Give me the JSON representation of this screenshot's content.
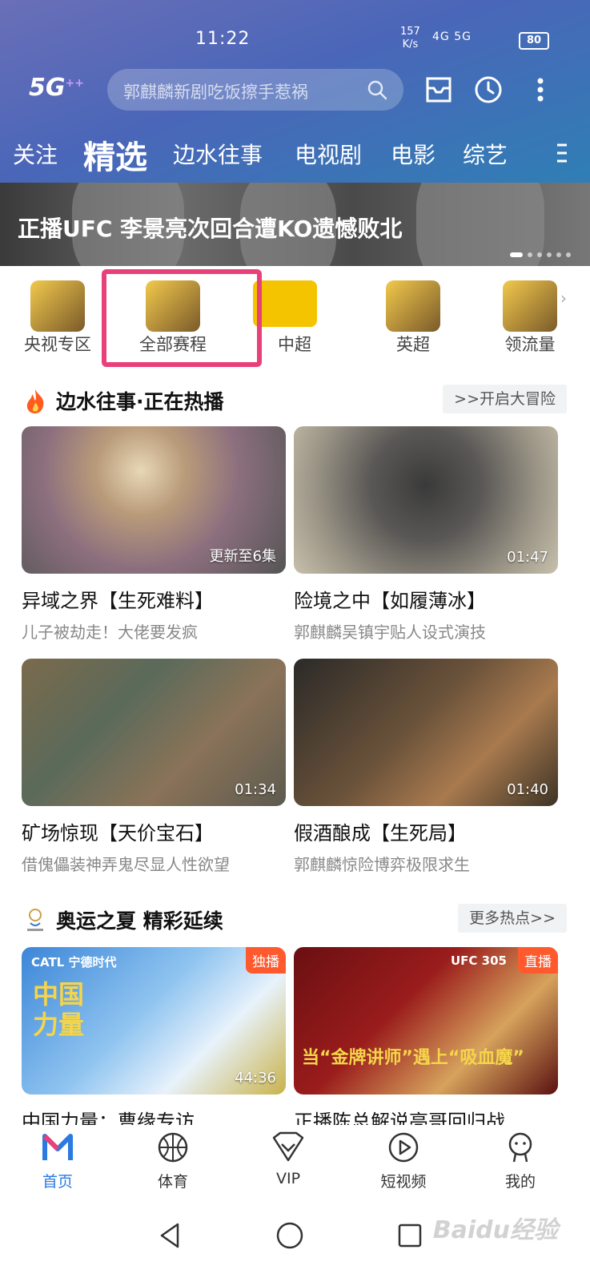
{
  "status_bar": {
    "time": "11:22",
    "net_speed": "157",
    "net_unit": "K/s",
    "signal": "4G 5G",
    "battery": "80"
  },
  "header": {
    "logo": "5G",
    "search_placeholder": "郭麒麟新剧吃饭擦手惹祸",
    "icons": [
      "search-icon",
      "inbox-icon",
      "history-icon",
      "more-icon"
    ]
  },
  "tabs": [
    {
      "label": "关注",
      "active": false
    },
    {
      "label": "精选",
      "active": true
    },
    {
      "label": "边水往事",
      "active": false
    },
    {
      "label": "电视剧",
      "active": false
    },
    {
      "label": "电影",
      "active": false
    },
    {
      "label": "综艺",
      "active": false
    }
  ],
  "banner": {
    "title": "正播UFC 李景亮次回合遭KO遗憾败北",
    "page_count": 6,
    "current_page": 1
  },
  "channels": [
    {
      "label": "央视专区"
    },
    {
      "label": "全部赛程"
    },
    {
      "label": "中超"
    },
    {
      "label": "英超"
    },
    {
      "label": "领流量"
    }
  ],
  "section1": {
    "title": "边水往事·正在热播",
    "more": ">>开启大冒险",
    "cards": [
      {
        "title": "异域之界【生死难料】",
        "subtitle": "儿子被劫走！大佬要发疯",
        "badge": "更新至6集"
      },
      {
        "title": "险境之中【如履薄冰】",
        "subtitle": "郭麒麟吴镇宇贴人设式演技",
        "badge": "01:47"
      },
      {
        "title": "矿场惊现【天价宝石】",
        "subtitle": "借傀儡装神弄鬼尽显人性欲望",
        "badge": "01:34"
      },
      {
        "title": "假酒酿成【生死局】",
        "subtitle": "郭麒麟惊险博弈极限求生",
        "badge": "01:40"
      }
    ]
  },
  "section2": {
    "title": "奥运之夏 精彩延续",
    "more": "更多热点>>",
    "cards": [
      {
        "title": "中国力量：曹缘专访",
        "tag": "独播",
        "badge": "44:36",
        "overlay_brand": "CATL 宁德时代",
        "overlay_big": "中国力量"
      },
      {
        "title": "正播陈总解说亮哥回归战",
        "tag": "直播",
        "overlay_brand": "UFC 305",
        "overlay_big": "当“金牌讲师”遇上“吸血魔”"
      }
    ]
  },
  "bottom_nav": [
    {
      "label": "首页",
      "icon": "home-logo-icon",
      "active": true
    },
    {
      "label": "体育",
      "icon": "basketball-icon",
      "active": false
    },
    {
      "label": "VIP",
      "icon": "vip-icon",
      "active": false
    },
    {
      "label": "短视频",
      "icon": "play-circle-icon",
      "active": false
    },
    {
      "label": "我的",
      "icon": "profile-icon",
      "active": false
    }
  ],
  "watermark": "Baidu经验",
  "colors": {
    "accent": "#2a7ae2",
    "highlight_box": "#e8407a",
    "tag": "#ff5a2e"
  }
}
